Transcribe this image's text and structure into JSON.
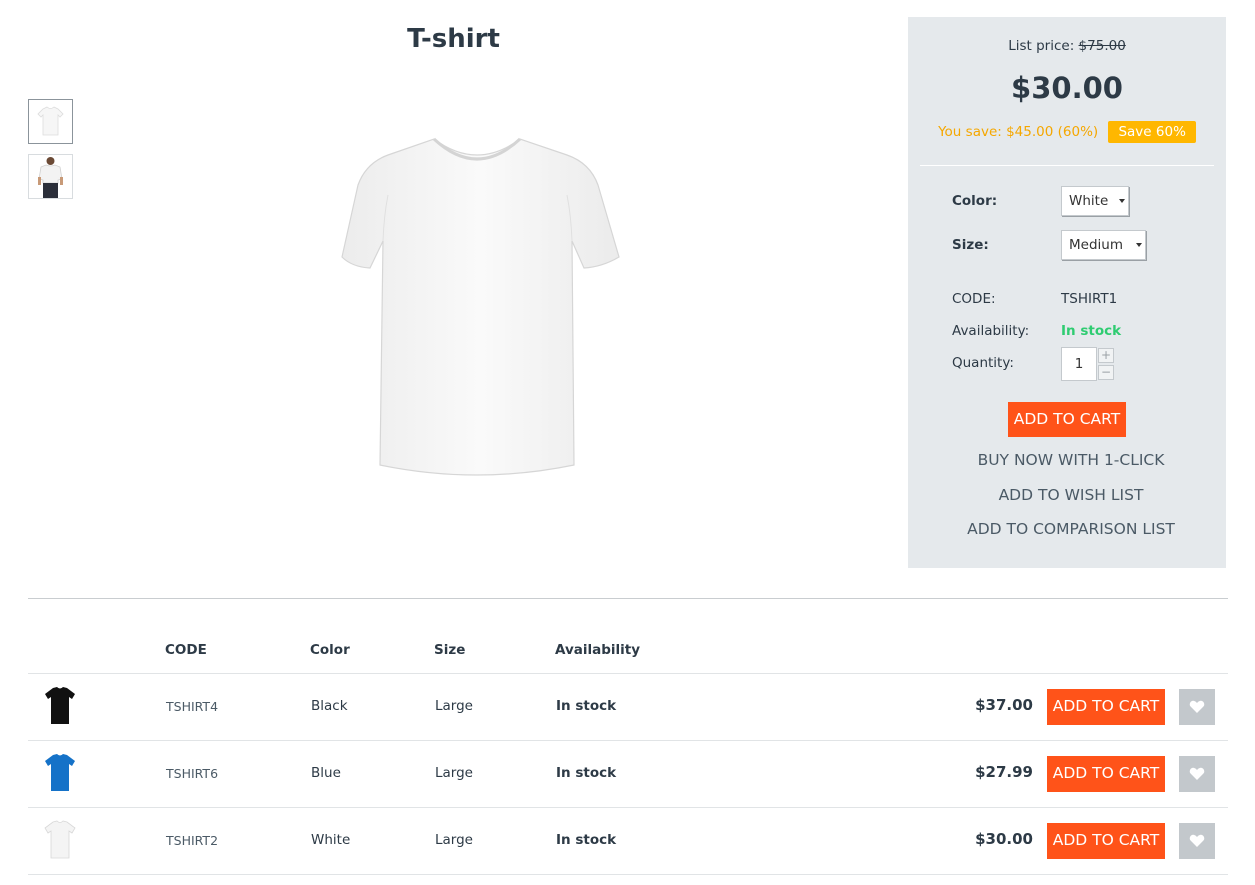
{
  "product": {
    "title": "T-shirt",
    "thumbnails": [
      "white-tshirt-icon",
      "model-tshirt-icon"
    ],
    "main_image": "white-tshirt-icon"
  },
  "pricing": {
    "list_price_label": "List price:",
    "list_price": "$75.00",
    "price": "$30.00",
    "you_save": "You save: $45.00 (60%)",
    "save_badge": "Save 60%"
  },
  "options": {
    "color_label": "Color:",
    "color_value": "White",
    "size_label": "Size:",
    "size_value": "Medium"
  },
  "info": {
    "code_label": "CODE:",
    "code_value": "TSHIRT1",
    "availability_label": "Availability:",
    "availability_value": "In stock",
    "quantity_label": "Quantity:",
    "quantity_value": "1",
    "plus": "+",
    "minus": "−"
  },
  "actions": {
    "add_to_cart": "ADD TO CART",
    "buy_now": "BUY NOW WITH 1-CLICK",
    "wish_list": "ADD TO WISH LIST",
    "comparison": "ADD TO COMPARISON LIST"
  },
  "variants": {
    "headers": [
      "CODE",
      "Color",
      "Size",
      "Availability"
    ],
    "rows": [
      {
        "code": "TSHIRT4",
        "color": "Black",
        "size": "Large",
        "availability": "In stock",
        "price": "$37.00",
        "swatch": "#111111"
      },
      {
        "code": "TSHIRT6",
        "color": "Blue",
        "size": "Large",
        "availability": "In stock",
        "price": "$27.99",
        "swatch": "#1572c8"
      },
      {
        "code": "TSHIRT2",
        "color": "White",
        "size": "Large",
        "availability": "In stock",
        "price": "$30.00",
        "swatch": "#f4f4f4"
      }
    ],
    "add_to_cart": "ADD TO CART",
    "wish_icon": "heart-icon"
  },
  "colors": {
    "accent": "#ff5319",
    "save_badge": "#ffb700",
    "in_stock": "#2ecc71",
    "sidebar_bg": "#e5e9ec"
  }
}
